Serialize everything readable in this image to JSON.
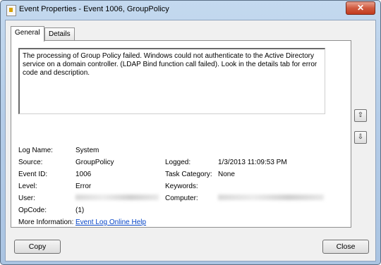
{
  "window": {
    "title": "Event Properties - Event 1006, GroupPolicy",
    "close_glyph": "✕"
  },
  "tabs": [
    {
      "label": "General",
      "active": true
    },
    {
      "label": "Details",
      "active": false
    }
  ],
  "description": "The processing of Group Policy failed. Windows could not authenticate to the Active Directory service on a domain controller. (LDAP Bind function call failed). Look in the details tab for error code and description.",
  "fields": {
    "log_name": {
      "label": "Log Name:",
      "value": "System"
    },
    "source": {
      "label": "Source:",
      "value": "GroupPolicy"
    },
    "logged": {
      "label": "Logged:",
      "value": "1/3/2013 11:09:53 PM"
    },
    "event_id": {
      "label": "Event ID:",
      "value": "1006"
    },
    "task_category": {
      "label": "Task Category:",
      "value": "None"
    },
    "level": {
      "label": "Level:",
      "value": "Error"
    },
    "keywords": {
      "label": "Keywords:",
      "value": ""
    },
    "user": {
      "label": "User:",
      "value": ""
    },
    "computer": {
      "label": "Computer:",
      "value": ""
    },
    "opcode": {
      "label": "OpCode:",
      "value": "(1)"
    },
    "more_info": {
      "label": "More Information:",
      "link": "Event Log Online Help"
    }
  },
  "nav": {
    "up_glyph": "⇧",
    "down_glyph": "⇩"
  },
  "buttons": {
    "copy": "Copy",
    "close": "Close"
  },
  "colors": {
    "title_gradient": "#b5cde8",
    "close_button": "#c94a2c",
    "link": "#0645c7"
  }
}
